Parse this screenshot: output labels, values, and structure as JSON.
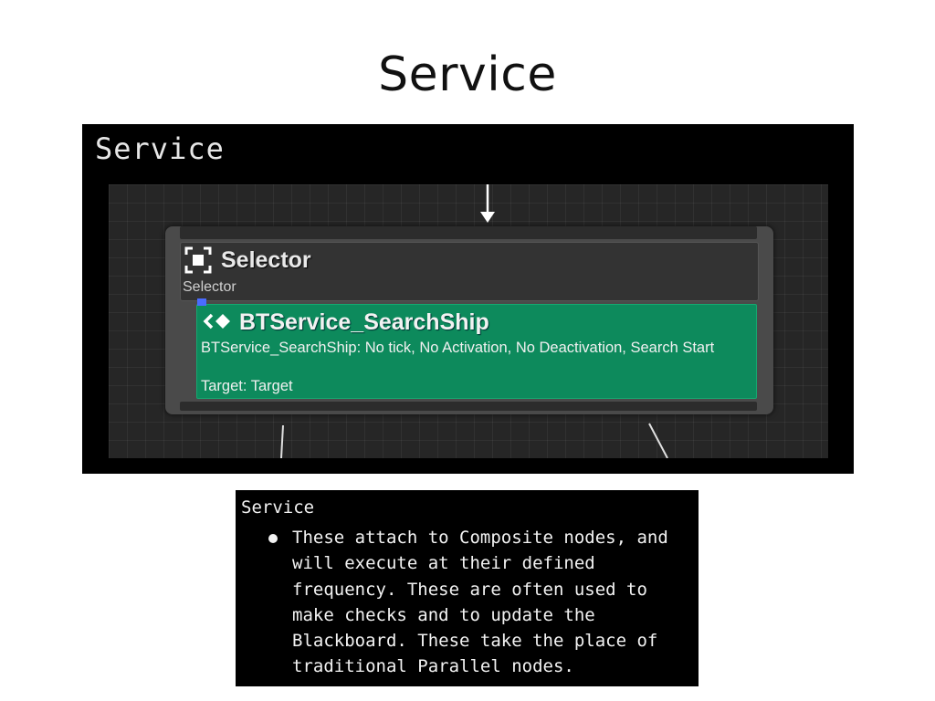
{
  "slide": {
    "title": "Service"
  },
  "editor": {
    "panel_title": "Service",
    "selector_node": {
      "name": "Selector",
      "subtitle": "Selector",
      "icon": "selector-icon"
    },
    "service_node": {
      "name": "BTService_SearchShip",
      "description": "BTService_SearchShip: No tick, No Activation, No Deactivation, Search Start",
      "target": "Target: Target",
      "icon": "service-icon",
      "color": "#0d8a5c"
    }
  },
  "description_box": {
    "heading": "Service",
    "bullet": "These attach to Composite nodes, and will execute at their defined frequency. These are often used to make checks and to update the Blackboard. These take the place of traditional Parallel nodes."
  }
}
